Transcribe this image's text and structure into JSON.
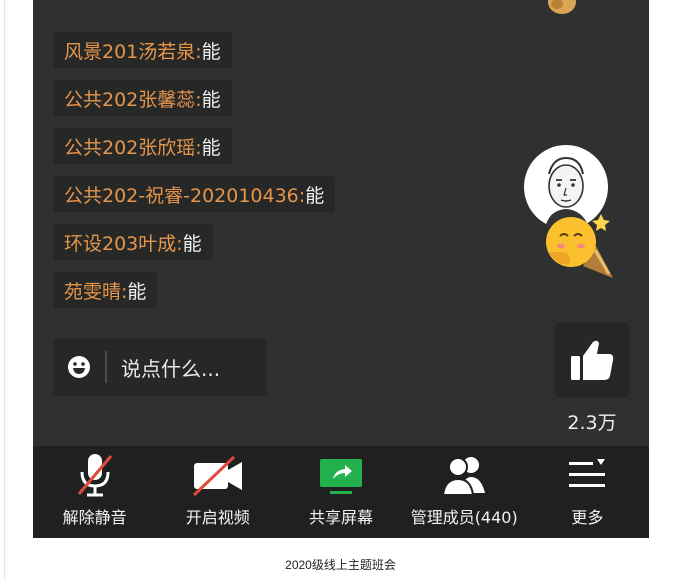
{
  "chat": {
    "messages": [
      {
        "name": "风景201汤若泉:",
        "text": " 能"
      },
      {
        "name": "公共202张馨蕊:",
        "text": " 能"
      },
      {
        "name": "公共202张欣瑶:",
        "text": " 能"
      },
      {
        "name": "公共202-祝睿-202010436:",
        "text": " 能"
      },
      {
        "name": "环设203叶成:",
        "text": " 能"
      },
      {
        "name": "苑雯晴:",
        "text": " 能"
      }
    ],
    "input_placeholder": "说点什么..."
  },
  "reactions": {
    "like_count": "2.3万"
  },
  "toolbar": {
    "unmute": "解除静音",
    "start_video": "开启视频",
    "share_screen": "共享屏幕",
    "manage_members": "管理成员(440)",
    "more": "更多"
  },
  "caption": "2020级线上主题班会",
  "colors": {
    "background": "#2f3030",
    "chat_bubble": "#262727",
    "toolbar": "#1f2020",
    "name": "#e6954a",
    "share_green": "#22b14c",
    "muted_red": "#e04a3a"
  }
}
